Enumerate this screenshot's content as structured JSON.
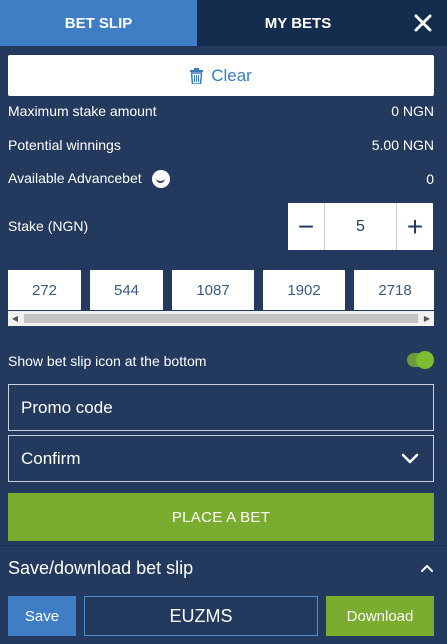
{
  "tabs": {
    "bet_slip": "BET SLIP",
    "my_bets": "MY BETS",
    "close_icon": "close-icon"
  },
  "clear": {
    "label": "Clear",
    "icon": "trash-icon"
  },
  "summary": {
    "max_stake_label": "Maximum stake amount",
    "max_stake_value": "0 NGN",
    "potential_label": "Potential winnings",
    "potential_value": "5.00 NGN",
    "advancebet_label": "Available Advancebet",
    "advancebet_value": "0"
  },
  "stake": {
    "label": "Stake (NGN)",
    "value": "5",
    "minus": "−",
    "plus": "+"
  },
  "quick_amounts": [
    "272",
    "544",
    "1087",
    "1902",
    "2718"
  ],
  "show_icon": {
    "label": "Show bet slip icon at the bottom",
    "enabled": true
  },
  "promo": {
    "placeholder": "Promo code"
  },
  "confirm": {
    "selected": "Confirm"
  },
  "place_bet": {
    "label": "PLACE A BET"
  },
  "save_section": {
    "title": "Save/download bet slip",
    "save_label": "Save",
    "code_value": "EUZMS",
    "download_label": "Download"
  },
  "colors": {
    "background": "#233a5e",
    "tab_active": "#3f7ec4",
    "accent_green": "#7aad2f"
  }
}
